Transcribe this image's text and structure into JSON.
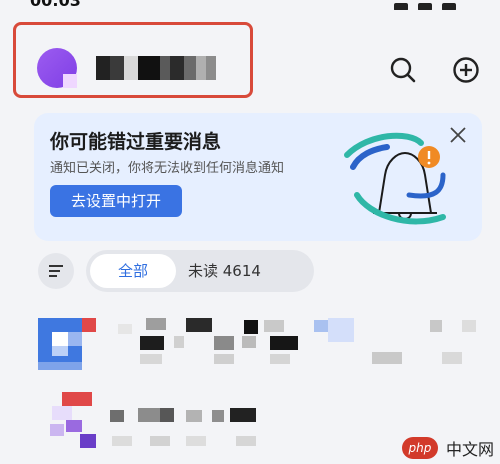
{
  "status_bar": {
    "time": "00:03"
  },
  "header": {
    "search_icon": "search-icon",
    "add_icon": "plus-circle-icon"
  },
  "banner": {
    "title": "你可能错过重要消息",
    "subtitle": "通知已关闭，你将无法收到任何消息通知",
    "button_label": "去设置中打开",
    "accent": "#3a73e3",
    "badge_color": "#f08a24"
  },
  "filters": {
    "tab_all": "全部",
    "tab_unread": "未读 4614"
  },
  "watermark": {
    "logo_text": "php",
    "site_text": "中文网"
  }
}
